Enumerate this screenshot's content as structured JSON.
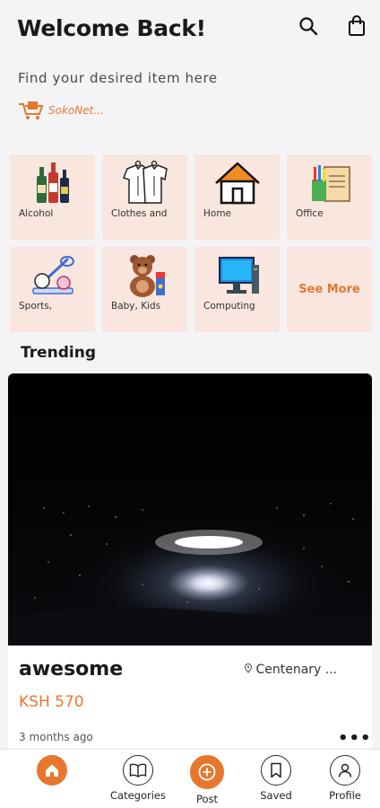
{
  "header": {
    "title": "Welcome Back!",
    "subtitle": "Find your desired item here",
    "logo_text": "SokoNet..."
  },
  "categories": [
    {
      "label": "Alcohol",
      "icon": "alcohol-bottles-icon"
    },
    {
      "label": "Clothes and",
      "icon": "clothes-icon"
    },
    {
      "label": "Home",
      "icon": "house-icon"
    },
    {
      "label": "Office",
      "icon": "office-supplies-icon"
    },
    {
      "label": "Sports,",
      "icon": "sports-icon"
    },
    {
      "label": "Baby, Kids",
      "icon": "teddy-bear-icon"
    },
    {
      "label": "Computing",
      "icon": "computer-icon"
    },
    {
      "label": "See More",
      "icon": ""
    }
  ],
  "trending": {
    "heading": "Trending",
    "item": {
      "name": "awesome",
      "location": "Centenary ...",
      "price": "KSH 570",
      "posted": "3 months ago",
      "more": "•••"
    }
  },
  "nav": {
    "home": "",
    "categories": "Categories",
    "post": "Post",
    "saved": "Saved",
    "profile": "Profile"
  },
  "colors": {
    "accent": "#e8772e",
    "tile_bg": "#f8e6df",
    "page_bg": "#f4f4f6"
  }
}
